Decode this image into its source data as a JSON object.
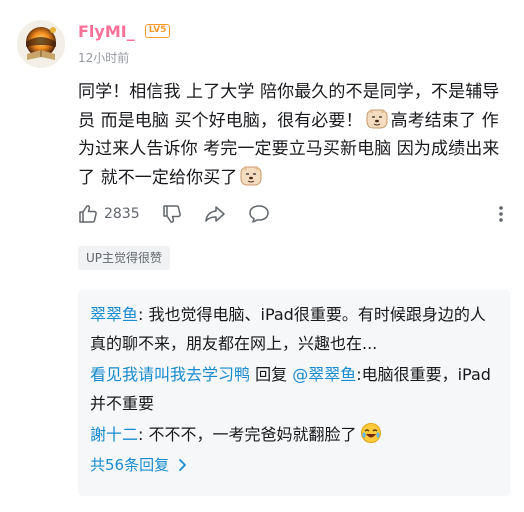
{
  "comment": {
    "username": "FlyMI_",
    "level": "LV5",
    "timestamp": "12小时前",
    "text_part1": "同学！相信我 上了大学 陪你最久的不是同学，不是辅导员 而是电脑 买个好电脑，很有必要！",
    "text_part2": "高考结束了 作为过来人告诉你 考完一定要立马买新电脑 因为成绩出来了 就不一定给你买了",
    "likes": "2835",
    "up_badge": "UP主觉得很赞"
  },
  "replies": [
    {
      "name": "翠翠鱼",
      "separator": ": ",
      "text": "我也觉得电脑、iPad很重要。有时候跟身边的人真的聊不来，朋友都在网上，兴趣也在..."
    },
    {
      "name": "看见我请叫我去学习鸭",
      "middle": " 回复 ",
      "mention": "@翠翠鱼",
      "separator": ":",
      "text": "电脑很重要，iPad并不重要"
    },
    {
      "name": "謝十二",
      "separator": ": ",
      "text": "不不不，一考完爸妈就翻脸了"
    }
  ],
  "more_replies": "共56条回复",
  "icons": [
    "like-icon",
    "dislike-icon",
    "share-icon",
    "reply-icon",
    "more-icon",
    "dog-emoji-icon",
    "laugh-cry-emoji-icon",
    "chevron-right-icon"
  ],
  "colors": {
    "username": "#fb7299",
    "level": "#ff9a2e",
    "link": "#178bcf",
    "muted": "#9499a0",
    "reply_bg": "#f6f7f8"
  }
}
